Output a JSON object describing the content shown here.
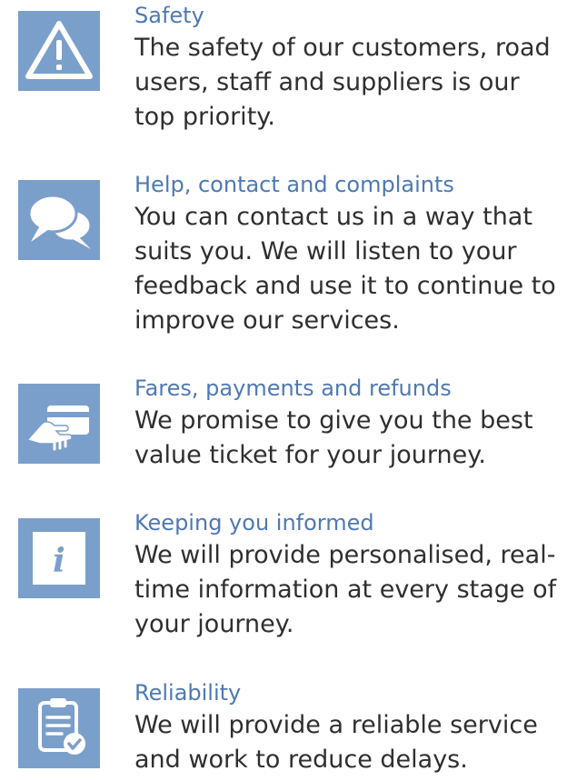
{
  "colors": {
    "icon_background": "#7b9fcb",
    "title": "#4f79b3",
    "body_text": "#2f2f2f"
  },
  "items": [
    {
      "icon": "warning-icon",
      "title": "Safety",
      "description": "The safety of our customers, road users, staff and suppliers is our top priority."
    },
    {
      "icon": "speech-bubbles-icon",
      "title": "Help, contact and complaints",
      "description": "You can contact us in a way that suits you. We will listen to your feedback and use it to continue to improve our services."
    },
    {
      "icon": "card-payment-icon",
      "title": "Fares, payments and refunds",
      "description": "We promise to give you the best value ticket for your journey."
    },
    {
      "icon": "information-icon",
      "title": "Keeping you informed",
      "description": "We will provide personalised, real-time information at every stage of your journey."
    },
    {
      "icon": "clipboard-check-icon",
      "title": "Reliability",
      "description": "We will provide a reliable service and work to reduce delays."
    }
  ]
}
